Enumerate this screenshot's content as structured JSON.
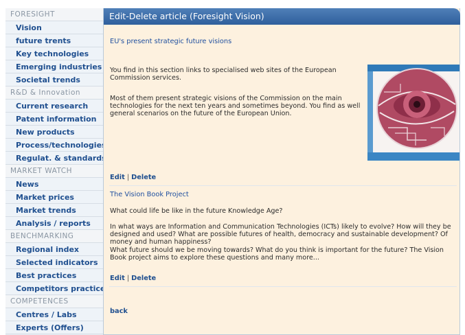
{
  "sidebar": {
    "sections": [
      {
        "title": "FORESIGHT",
        "items": [
          "Vision",
          "future trents",
          "Key technologies",
          "Emerging industries",
          "Societal trends"
        ]
      },
      {
        "title": "R&D & Innovation",
        "items": [
          "Current research",
          "Patent information",
          "New products",
          "Process/technologies",
          "Regulat. & standards"
        ]
      },
      {
        "title": "MARKET WATCH",
        "items": [
          "News",
          "Market prices",
          "Market trends",
          "Analysis / reports"
        ]
      },
      {
        "title": "BENCHMARKING",
        "items": [
          "Regional index",
          "Selected indicators",
          "Best practices",
          "Competitors practices"
        ]
      },
      {
        "title": "COMPETENCES",
        "items": [
          "Centres / Labs",
          "Experts (Offers)"
        ]
      }
    ]
  },
  "main": {
    "header": "Edit-Delete article (Foresight Vision)",
    "articles": [
      {
        "title": "EU's present strategic future visions",
        "p1": "You find in this section links to specialised web sites of the European Commission services.",
        "p2": "Most of them present strategic visions of the Commission on the main technologies for the next ten years and sometimes beyond. You find as well general scenarios on the future of the European Union.",
        "edit": "Edit",
        "sep": "|",
        "delete": "Delete"
      },
      {
        "title": "The Vision Book Project",
        "p1": "What could life be like in the future Knowledge Age?",
        "p2": "In what ways are Information and Communication Technologies (ICTs) likely to evolve?  How will they be designed and used? What are possible futures of health, democracy and sustainable development? Of money and human happiness?",
        "p3": "What future should we be moving towards?  What do you think is important for the future?  The Vision Book project aims to explore these questions and many more...",
        "edit": "Edit",
        "sep": "|",
        "delete": "Delete"
      }
    ],
    "back": "back"
  },
  "colors": {
    "header_bg": "#3f6fad",
    "panel_bg": "#fdf1df",
    "sidebar_item_text": "#1f4f8f",
    "sidebar_section_text": "#8a96a3",
    "link_text": "#1f4f9f"
  }
}
